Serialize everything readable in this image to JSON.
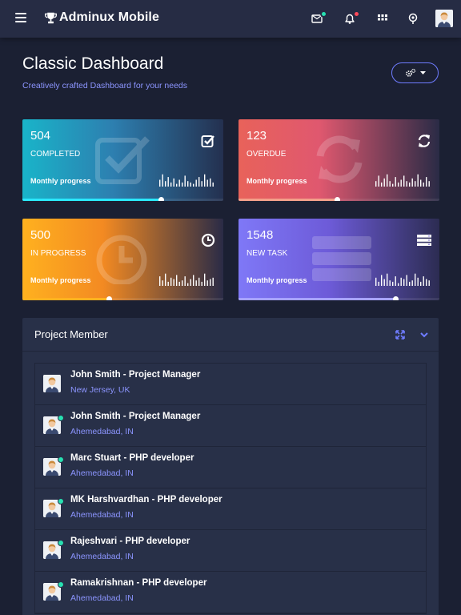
{
  "app": {
    "title": "Adminux Mobile",
    "colors": {
      "topbar_bg": "#262c44",
      "page_bg": "#1b2033",
      "accent": "#8c95ff",
      "online": "#27e0b1",
      "notify_teal": "#27e0b1",
      "notify_red": "#ff4a5a"
    }
  },
  "header": {
    "icons": [
      "menu-icon",
      "trophy-icon",
      "mail-icon",
      "bell-icon",
      "apps-grid-icon",
      "location-pin-icon"
    ],
    "user_avatar": "avatar"
  },
  "page": {
    "title": "Classic Dashboard",
    "subtitle": "Creatively crafted Dashboard for your needs",
    "settings_icon": "gears-icon"
  },
  "cards": [
    {
      "value": "504",
      "label": "COMPLETED",
      "sub": "Monthly progress",
      "icon": "checkbox-icon",
      "progress": 0.69,
      "fill": "#2be8ff"
    },
    {
      "value": "123",
      "label": "OVERDUE",
      "sub": "Monthly progress",
      "icon": "refresh-icon",
      "progress": 0.49,
      "fill": "#f3a08a"
    },
    {
      "value": "500",
      "label": "IN PROGRESS",
      "sub": "Monthly progress",
      "icon": "clock-icon",
      "progress": 0.43,
      "fill": "#ffb11f"
    },
    {
      "value": "1548",
      "label": "NEW TASK",
      "sub": "Monthly progress",
      "icon": "server-icon",
      "progress": 0.78,
      "fill": "#a7a3ff"
    }
  ],
  "panel": {
    "title": "Project Member",
    "tools": [
      "expand-icon",
      "chevron-down-icon"
    ],
    "members": [
      {
        "name": "John Smith - Project Manager",
        "location": "New Jersey, UK",
        "online": false
      },
      {
        "name": "John Smith - Project Manager",
        "location": "Ahemedabad, IN",
        "online": true
      },
      {
        "name": "Marc Stuart - PHP developer",
        "location": "Ahemedabad, IN",
        "online": true
      },
      {
        "name": "MK Harshvardhan - PHP developer",
        "location": "Ahemedabad, IN",
        "online": true
      },
      {
        "name": "Rajeshvari - PHP developer",
        "location": "Ahemedabad, IN",
        "online": true
      },
      {
        "name": "Ramakrishnan - PHP developer",
        "location": "Ahemedabad, IN",
        "online": true
      }
    ]
  }
}
